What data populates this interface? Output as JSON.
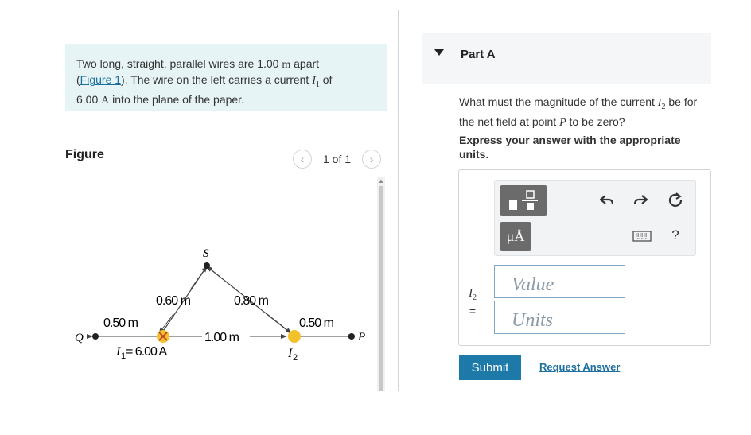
{
  "problem": {
    "text_part1": "Two long, straight, parallel wires are 1.00",
    "unit_m": "m",
    "text_part2": " apart",
    "open_paren": "(",
    "figure_link": "Figure 1",
    "text_part3": "). The wire on the left carries a current",
    "current_symbol": "I",
    "current_sub": "1",
    "text_part4": " of",
    "value": "6.00",
    "unit_A": "A",
    "text_part5": " into the plane of the paper."
  },
  "figure": {
    "label": "Figure",
    "pager_text": "1 of 1",
    "prev_icon": "chevron-left",
    "next_icon": "chevron-right",
    "labels": {
      "S": "S",
      "Q": "Q",
      "P": "P",
      "d1": "0.60 m",
      "d2": "0.80 m",
      "d3": "0.50 m",
      "d4": "1.00 m",
      "d5": "0.50 m",
      "I1": "I",
      "I1_sub": "1",
      "I1_value": " = 6.00 A",
      "I2": "I",
      "I2_sub": "2"
    },
    "colors": {
      "wire_marker": "#f3c12b",
      "wire_x": "#c0392b"
    }
  },
  "partA": {
    "title": "Part A",
    "question_1": "What must the magnitude of the current",
    "question_sym": "I",
    "question_sub": "2",
    "question_2": " be for the net field at point",
    "question_P": "P",
    "question_3": " to be zero?",
    "instruction": "Express your answer with the appropriate units.",
    "toolbar": {
      "template_icon": "fraction-template",
      "units_label": "μÅ",
      "undo_icon": "undo",
      "redo_icon": "redo",
      "reset_icon": "reset",
      "keyboard_icon": "keyboard",
      "help_label": "?"
    },
    "variable": "I",
    "variable_sub": "2",
    "equals": "=",
    "value_placeholder": "Value",
    "units_placeholder": "Units",
    "submit_label": "Submit",
    "request_label": "Request Answer"
  }
}
